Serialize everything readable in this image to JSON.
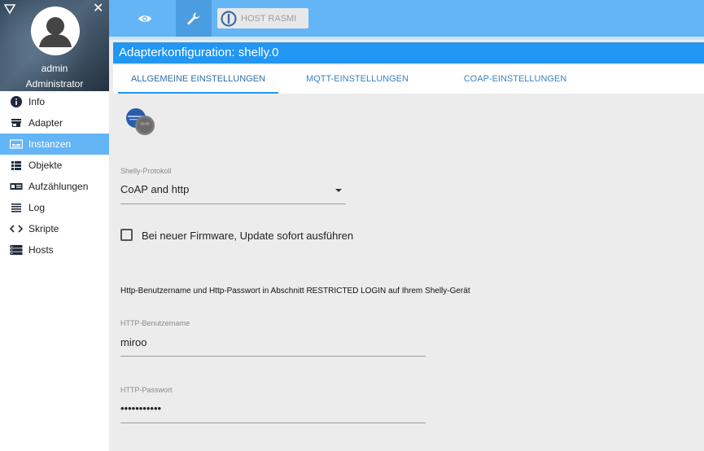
{
  "sidebar": {
    "user_name": "admin",
    "user_role": "Administrator",
    "items": [
      {
        "label": "Info",
        "icon": "info-icon"
      },
      {
        "label": "Adapter",
        "icon": "store-icon"
      },
      {
        "label": "Instanzen",
        "icon": "instances-icon",
        "active": true
      },
      {
        "label": "Objekte",
        "icon": "list-icon"
      },
      {
        "label": "Aufzählungen",
        "icon": "enum-icon"
      },
      {
        "label": "Log",
        "icon": "log-icon"
      },
      {
        "label": "Skripte",
        "icon": "code-icon"
      },
      {
        "label": "Hosts",
        "icon": "hosts-icon"
      }
    ]
  },
  "topbar": {
    "host_label": "HOST RASMI"
  },
  "page": {
    "title": "Adapterkonfiguration: shelly.0"
  },
  "tabs": [
    {
      "label": "ALLGEMEINE EINSTELLUNGEN",
      "active": true
    },
    {
      "label": "MQTT-EINSTELLUNGEN"
    },
    {
      "label": "COAP-EINSTELLUNGEN"
    }
  ],
  "form": {
    "protocol_label": "Shelly-Protokoll",
    "protocol_value": "CoAP and http",
    "auto_update_label": "Bei neuer Firmware, Update sofort ausführen",
    "auto_update_checked": false,
    "info_text": "Http-Benutzername und Http-Passwort in Abschnitt RESTRICTED LOGIN auf Ihrem Shelly-Gerät",
    "username_label": "HTTP-Benutzername",
    "username_value": "miroo",
    "password_label": "HTTP-Passwort",
    "password_value": "•••••••••••"
  },
  "colors": {
    "accent": "#2196f3",
    "topbar": "#64b5f6",
    "active_nav": "#64b5f6"
  }
}
